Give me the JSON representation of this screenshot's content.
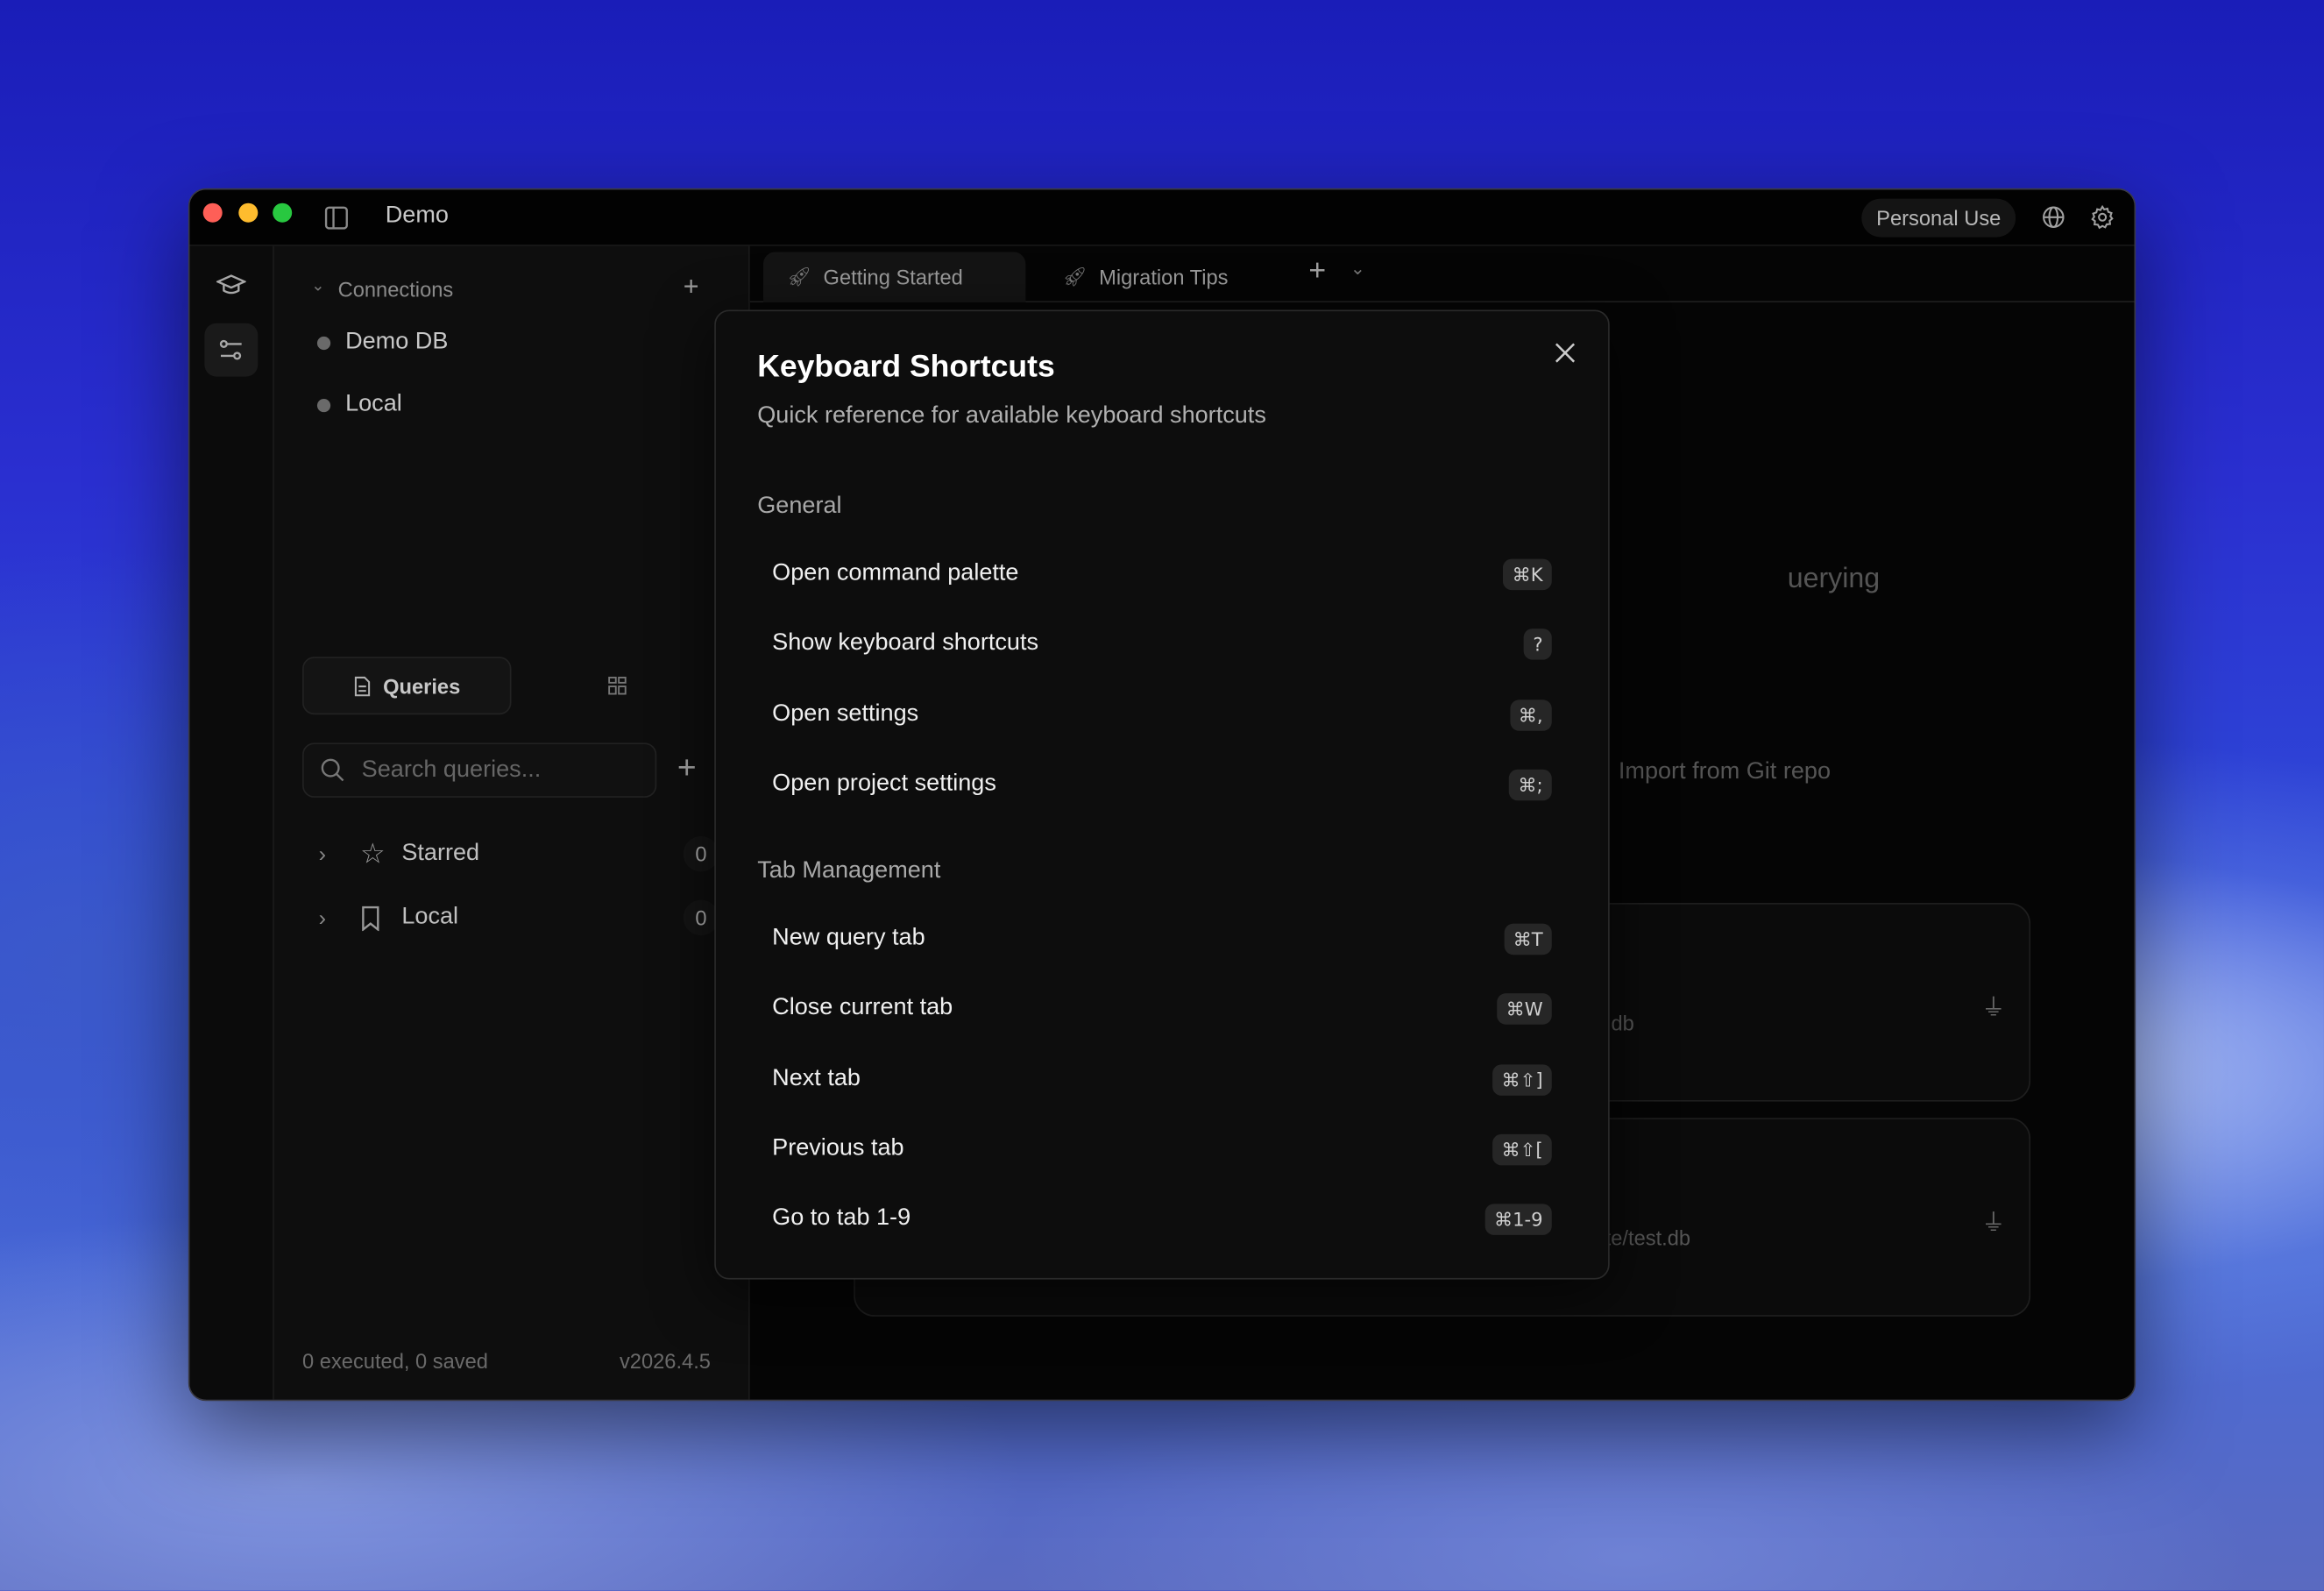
{
  "window": {
    "title": "Demo",
    "plan_badge": "Personal Use"
  },
  "sidebar": {
    "connections_header": "Connections",
    "connections": [
      {
        "name": "Demo DB"
      },
      {
        "name": "Local"
      }
    ],
    "queries_tab": "Queries",
    "search_placeholder": "Search queries...",
    "groups": [
      {
        "label": "Starred",
        "count": "0"
      },
      {
        "label": "Local",
        "count": "0"
      }
    ],
    "footer_stats": "0 executed, 0 saved",
    "version": "v2026.4.5"
  },
  "tabs": [
    {
      "label": "Getting Started",
      "active": true
    },
    {
      "label": "Migration Tips",
      "active": false
    }
  ],
  "background_content": {
    "heading_fragment": "uerying",
    "import_link": "Import from Git repo",
    "card1_path": "db",
    "card2_path": "te/test.db"
  },
  "modal": {
    "title": "Keyboard Shortcuts",
    "subtitle": "Quick reference for available keyboard shortcuts",
    "sections": [
      {
        "title": "General",
        "items": [
          {
            "label": "Open command palette",
            "keys": "⌘K"
          },
          {
            "label": "Show keyboard shortcuts",
            "keys": "?"
          },
          {
            "label": "Open settings",
            "keys": "⌘,"
          },
          {
            "label": "Open project settings",
            "keys": "⌘;"
          }
        ]
      },
      {
        "title": "Tab Management",
        "items": [
          {
            "label": "New query tab",
            "keys": "⌘T"
          },
          {
            "label": "Close current tab",
            "keys": "⌘W"
          },
          {
            "label": "Next tab",
            "keys": "⌘⇧]"
          },
          {
            "label": "Previous tab",
            "keys": "⌘⇧["
          },
          {
            "label": "Go to tab 1-9",
            "keys": "⌘1-9"
          }
        ]
      }
    ]
  },
  "colors": {
    "close": "#fe5f57",
    "minimize": "#febc2e",
    "zoom": "#28c840"
  }
}
